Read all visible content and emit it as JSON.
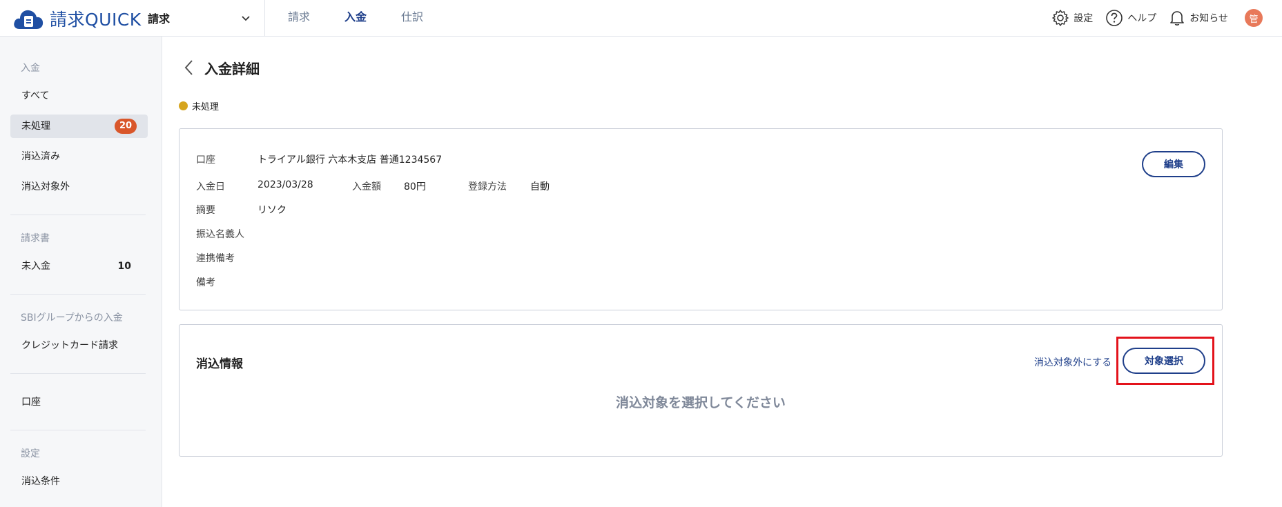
{
  "header": {
    "brand": "請求QUICK",
    "product_selector": "請求",
    "nav": [
      {
        "label": "請求",
        "active": false
      },
      {
        "label": "入金",
        "active": true
      },
      {
        "label": "仕訳",
        "active": false
      }
    ],
    "settings_label": "設定",
    "help_label": "ヘルプ",
    "notifications_label": "お知らせ",
    "avatar_initial": "管"
  },
  "sidebar": {
    "sections": [
      {
        "title": "入金",
        "items": [
          {
            "label": "すべて"
          },
          {
            "label": "未処理",
            "badge": "20",
            "active": true
          },
          {
            "label": "消込済み"
          },
          {
            "label": "消込対象外"
          }
        ]
      },
      {
        "title": "請求書",
        "items": [
          {
            "label": "未入金",
            "count": "10"
          }
        ]
      },
      {
        "title": "SBIグループからの入金",
        "items": [
          {
            "label": "クレジットカード請求"
          }
        ]
      },
      {
        "title": "",
        "items": [
          {
            "label": "口座"
          }
        ]
      },
      {
        "title": "設定",
        "items": [
          {
            "label": "消込条件"
          }
        ]
      }
    ]
  },
  "main": {
    "title": "入金詳細",
    "status_label": "未処理",
    "status_color": "#d6a51e",
    "details": {
      "account_label": "口座",
      "account_value": "トライアル銀行 六本木支店 普通1234567",
      "date_label": "入金日",
      "date_value": "2023/03/28",
      "amount_label": "入金額",
      "amount_value": "80円",
      "method_label": "登録方法",
      "method_value": "自動",
      "summary_label": "摘要",
      "summary_value": "リソク",
      "payer_label": "振込名義人",
      "link_note_label": "連携備考",
      "note_label": "備考",
      "edit_button": "編集"
    },
    "reconcile": {
      "title": "消込情報",
      "exclude_link": "消込対象外にする",
      "select_button": "対象選択",
      "empty_message": "消込対象を選択してください"
    }
  },
  "colors": {
    "brand": "#1f4fa3",
    "accent": "#1f3f8a",
    "badge": "#d9562a",
    "highlight": "#e3121b"
  }
}
